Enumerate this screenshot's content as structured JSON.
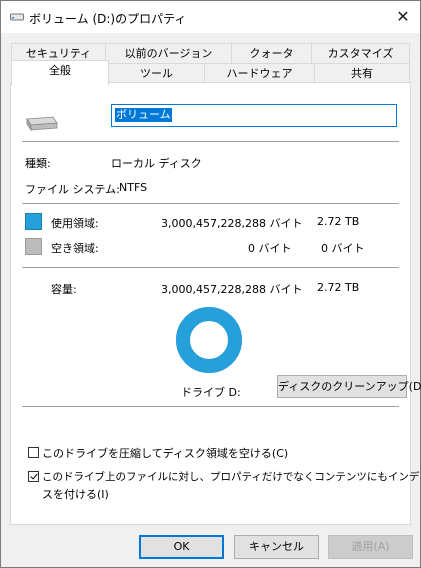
{
  "window": {
    "title": "ボリューム (D:)のプロパティ",
    "close_glyph": "✕"
  },
  "tabs": {
    "row1": [
      "セキュリティ",
      "以前のバージョン",
      "クォータ",
      "カスタマイズ"
    ],
    "row2": [
      "全般",
      "ツール",
      "ハードウェア",
      "共有"
    ],
    "active": "全般"
  },
  "general": {
    "volume_name": "ボリューム",
    "type_label": "種類:",
    "type_value": "ローカル ディスク",
    "fs_label": "ファイル システム:",
    "fs_value": "NTFS",
    "used_label": "使用領域:",
    "used_bytes": "3,000,457,228,288 バイト",
    "used_size": "2.72 TB",
    "free_label": "空き領域:",
    "free_bytes": "0 バイト",
    "free_size": "0 バイト",
    "capacity_label": "容量:",
    "capacity_bytes": "3,000,457,228,288 バイト",
    "capacity_size": "2.72 TB",
    "drive_label": "ドライブ D:",
    "cleanup_button": "ディスクのクリーンアップ(D)",
    "used_fraction": 1.0,
    "colors": {
      "used": "#26a0da",
      "free": "#bcbcbc"
    },
    "compress_label": "このドライブを圧縮してディスク領域を空ける(C)",
    "compress_checked": false,
    "index_label_line1": "このドライブ上のファイルに対し、プロパティだけでなくコンテンツにもインデック",
    "index_label_line2": "スを付ける(I)",
    "index_checked": true
  },
  "buttons": {
    "ok": "OK",
    "cancel": "キャンセル",
    "apply": "適用(A)"
  }
}
